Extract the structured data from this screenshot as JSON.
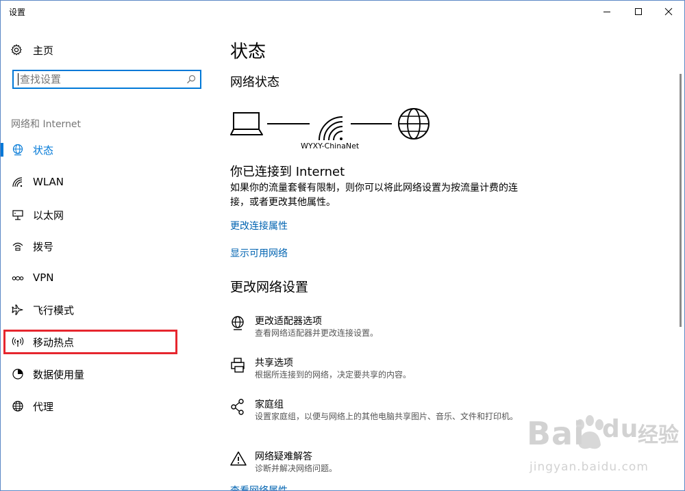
{
  "window": {
    "title": "设置"
  },
  "sidebar": {
    "home_label": "主页",
    "search_placeholder": "查找设置",
    "section_label": "网络和 Internet",
    "items": [
      {
        "label": "状态",
        "icon": "globe-status-icon",
        "active": true
      },
      {
        "label": "WLAN",
        "icon": "wifi-icon"
      },
      {
        "label": "以太网",
        "icon": "ethernet-icon"
      },
      {
        "label": "拨号",
        "icon": "dialup-icon"
      },
      {
        "label": "VPN",
        "icon": "vpn-icon"
      },
      {
        "label": "飞行模式",
        "icon": "airplane-icon"
      },
      {
        "label": "移动热点",
        "icon": "hotspot-icon"
      },
      {
        "label": "数据使用量",
        "icon": "data-usage-icon"
      },
      {
        "label": "代理",
        "icon": "globe-icon"
      }
    ]
  },
  "main": {
    "title": "状态",
    "network_status_heading": "网络状态",
    "network_name": "WYXY-ChinaNet",
    "connected_heading": "你已连接到 Internet",
    "connected_desc": "如果你的流量套餐有限制，则你可以将此网络设置为按流量计费的连接，或者更改其他属性。",
    "link_change_props": "更改连接属性",
    "link_show_networks": "显示可用网络",
    "change_heading": "更改网络设置",
    "options": [
      {
        "title": "更改适配器选项",
        "desc": "查看网络适配器并更改连接设置。",
        "icon": "adapter-globe-icon"
      },
      {
        "title": "共享选项",
        "desc": "根据所连接到的网络，决定要共享的内容。",
        "icon": "printer-icon"
      },
      {
        "title": "家庭组",
        "desc": "设置家庭组，以便与网络上的其他电脑共享图片、音乐、文件和打印机。",
        "icon": "homegroup-icon"
      },
      {
        "title": "网络疑难解答",
        "desc": "诊断并解决网络问题。",
        "icon": "warning-icon"
      }
    ],
    "link_view_props": "查看网络属性"
  },
  "watermark": {
    "brand": "Bai",
    "brand2": "du",
    "cn": "经验",
    "url": "jingyan.baidu.com"
  },
  "colors": {
    "accent": "#0078d7",
    "link": "#0063b1",
    "highlight": "#e6262e"
  }
}
